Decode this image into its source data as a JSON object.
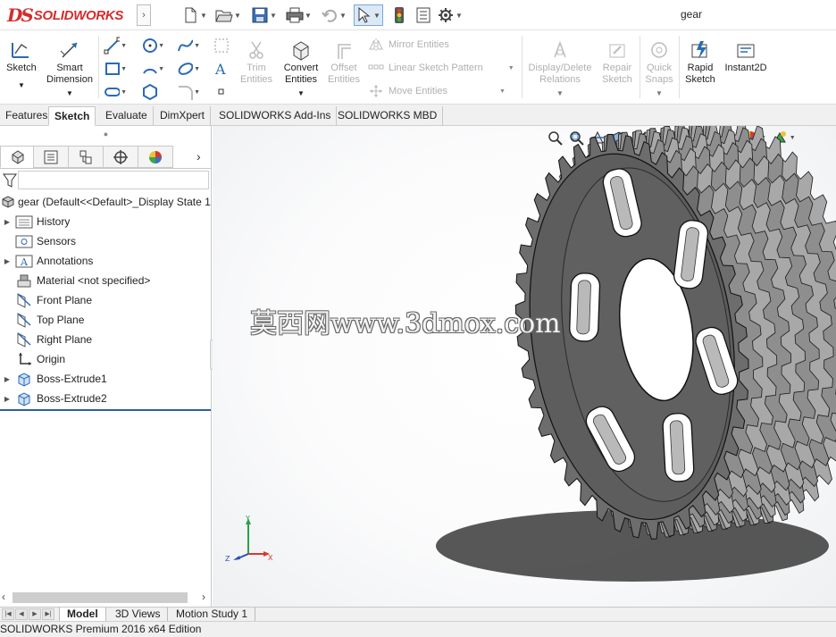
{
  "app": {
    "logo_ds": "DS",
    "logo_text": "SOLIDWORKS",
    "document_title": "gear"
  },
  "quick_access": [
    {
      "icon": "new-document-icon"
    },
    {
      "icon": "open-folder-icon"
    },
    {
      "icon": "save-icon"
    },
    {
      "icon": "print-icon"
    },
    {
      "icon": "undo-icon"
    },
    {
      "icon": "select-pointer-icon"
    },
    {
      "icon": "rebuild-traffic-light-icon"
    },
    {
      "icon": "file-properties-icon"
    },
    {
      "icon": "options-gear-icon"
    }
  ],
  "command_manager": {
    "sketch": "Sketch",
    "smart_dimension": [
      "Smart",
      "Dimension"
    ],
    "trim_entities": [
      "Trim",
      "Entities"
    ],
    "convert_entities": [
      "Convert",
      "Entities"
    ],
    "offset_entities": [
      "Offset",
      "Entities"
    ],
    "mirror_entities": "Mirror Entities",
    "linear_sketch_pattern": "Linear Sketch Pattern",
    "move_entities": "Move Entities",
    "display_delete_relations": [
      "Display/Delete",
      "Relations"
    ],
    "repair_sketch": [
      "Repair",
      "Sketch"
    ],
    "quick_snaps": [
      "Quick",
      "Snaps"
    ],
    "rapid_sketch": [
      "Rapid",
      "Sketch"
    ],
    "instant2d": "Instant2D"
  },
  "tabs": [
    "Features",
    "Sketch",
    "Evaluate",
    "DimXpert",
    "SOLIDWORKS Add-Ins",
    "SOLIDWORKS MBD"
  ],
  "active_tab": "Sketch",
  "feature_tree": {
    "root": "gear  (Default<<Default>_Display State 1",
    "items": [
      {
        "label": "History",
        "icon": "history-folder-icon",
        "expandable": true
      },
      {
        "label": "Sensors",
        "icon": "sensors-folder-icon",
        "expandable": false
      },
      {
        "label": "Annotations",
        "icon": "annotations-icon",
        "expandable": true
      },
      {
        "label": "Material <not specified>",
        "icon": "material-icon",
        "expandable": false
      },
      {
        "label": "Front Plane",
        "icon": "plane-icon",
        "expandable": false
      },
      {
        "label": "Top Plane",
        "icon": "plane-icon",
        "expandable": false
      },
      {
        "label": "Right Plane",
        "icon": "plane-icon",
        "expandable": false
      },
      {
        "label": "Origin",
        "icon": "origin-icon",
        "expandable": false
      },
      {
        "label": "Boss-Extrude1",
        "icon": "extrude-icon",
        "expandable": true
      },
      {
        "label": "Boss-Extrude2",
        "icon": "extrude-icon",
        "expandable": true
      }
    ]
  },
  "viewport": {
    "watermark": "莫西网www.3dmox.com",
    "triad": {
      "x": "X",
      "y": "Y",
      "z": "Z"
    }
  },
  "bottom_tabs": [
    "Model",
    "3D Views",
    "Motion Study 1"
  ],
  "active_bottom_tab": "Model",
  "status_bar": "SOLIDWORKS Premium 2016 x64 Edition"
}
